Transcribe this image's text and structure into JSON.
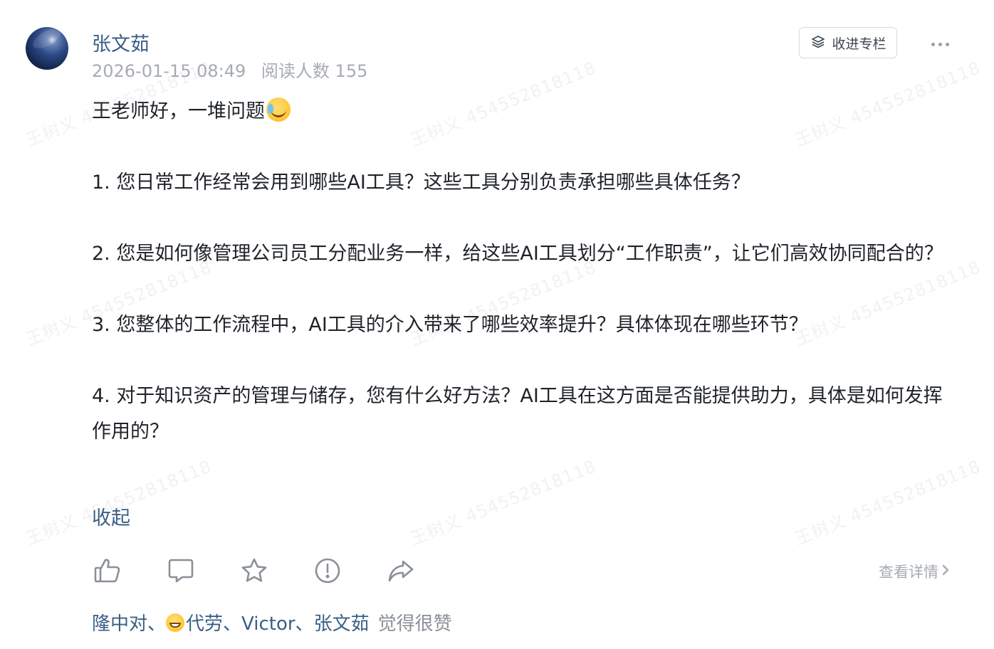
{
  "watermark": {
    "text": "王树义 454552818118"
  },
  "post": {
    "author": "张文茹",
    "date": "2026-01-15 08:49",
    "read_count": "阅读人数 155",
    "collect_label": "收进专栏",
    "greeting": "王老师好，一堆问题",
    "greeting_emoji": "crying-laughing-face-emoji",
    "questions": [
      "1. 您日常工作经常会用到哪些AI工具？这些工具分别负责承担哪些具体任务？",
      "2. 您是如何像管理公司员工分配业务一样，给这些AI工具划分“工作职责”，让它们高效协同配合的？",
      "3. 您整体的工作流程中，AI工具的介入带来了哪些效率提升？具体体现在哪些环节？",
      "4. 对于知识资产的管理与储存，您有什么好方法？AI工具在这方面是否能提供助力，具体是如何发挥作用的？"
    ],
    "collapse_label": "收起"
  },
  "actions": {
    "icons": [
      "thumbs-up-icon",
      "comment-icon",
      "star-icon",
      "report-icon",
      "share-icon"
    ],
    "detail_label": "查看详情"
  },
  "likes": {
    "user1": "隆中对、",
    "user2": "代劳、",
    "user3": "Victor、",
    "user4": "张文茹",
    "suffix": "觉得很赞"
  },
  "colors": {
    "link": "#3a5f86",
    "meta": "#a6abb3",
    "text": "#1f2329",
    "icon": "#8a9098"
  }
}
